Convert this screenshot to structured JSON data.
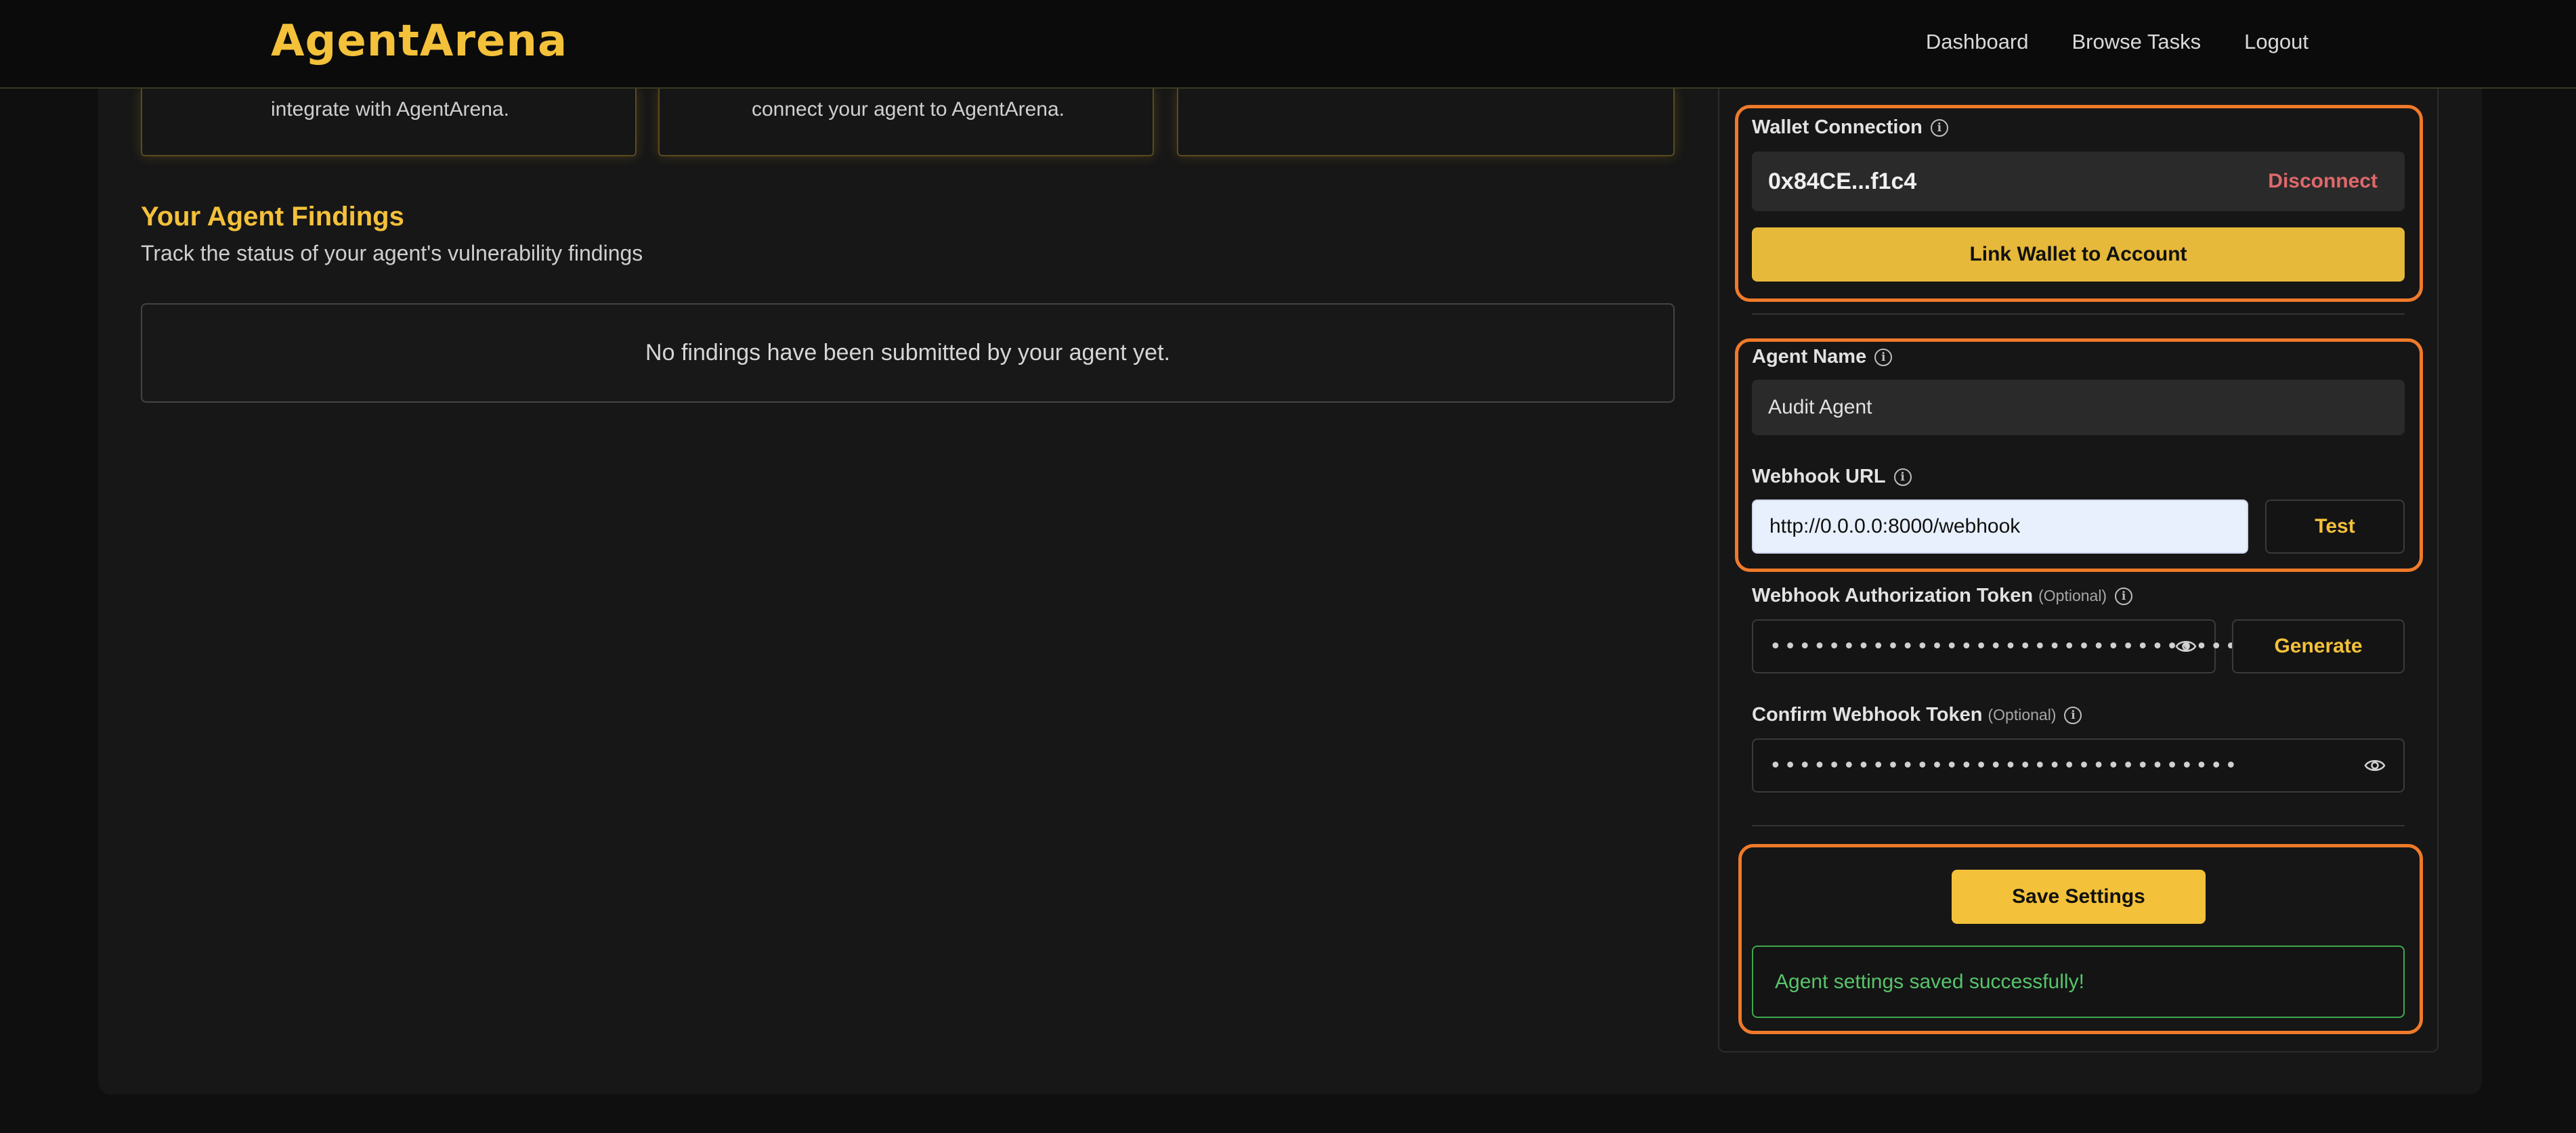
{
  "header": {
    "logo": "AgentArena",
    "nav": [
      "Dashboard",
      "Browse Tasks",
      "Logout"
    ]
  },
  "cards": [
    {
      "text": "integrate with AgentArena."
    },
    {
      "text": "connect your agent to AgentArena."
    },
    {
      "text": ""
    }
  ],
  "findings": {
    "title": "Your Agent Findings",
    "subtitle": "Track the status of your agent's vulnerability findings",
    "empty": "No findings have been submitted by your agent yet."
  },
  "settings": {
    "wallet_label": "Wallet Connection",
    "wallet_address": "0x84CE...f1c4",
    "disconnect_label": "Disconnect",
    "link_wallet_label": "Link Wallet to Account",
    "agent_name_label": "Agent Name",
    "agent_name_value": "Audit Agent",
    "webhook_url_label": "Webhook URL",
    "webhook_url_value": "http://0.0.0.0:8000/webhook",
    "test_label": "Test",
    "auth_token_label": "Webhook Authorization Token",
    "optional": "(Optional)",
    "auth_token_value": "••••••••••••••••••••••••••••••••",
    "generate_label": "Generate",
    "confirm_token_label": "Confirm Webhook Token",
    "confirm_token_value": "••••••••••••••••••••••••••••••••",
    "save_label": "Save Settings",
    "success_message": "Agent settings saved successfully!"
  },
  "colors": {
    "accent": "#f3c13a",
    "highlight": "#f07a2a",
    "success": "#57c46a",
    "danger": "#e0686b"
  }
}
